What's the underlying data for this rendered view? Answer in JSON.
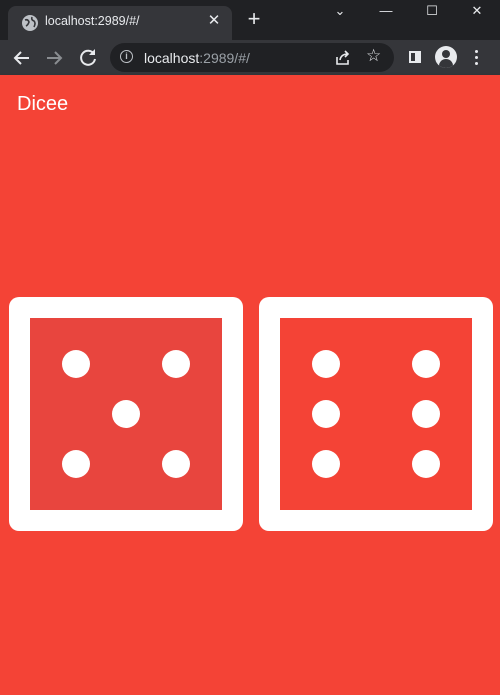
{
  "browser": {
    "tab_title": "localhost:2989/#/",
    "tab_close": "✕",
    "new_tab": "+",
    "url_host": "localhost",
    "url_rest": ":2989/#/",
    "controls": {
      "minimize": "—",
      "maximize": "☐",
      "close": "✕",
      "tab_search": "⌄"
    },
    "icons": {
      "back": "arrow-left-icon",
      "forward": "arrow-right-icon",
      "reload": "reload-icon",
      "info": "info-icon",
      "share": "share-icon",
      "bookmark": "star-icon",
      "side_panel": "side-panel-icon",
      "profile": "profile-icon",
      "menu": "kebab-menu-icon"
    }
  },
  "app": {
    "title": "Dicee",
    "theme": {
      "primary": "#f44336",
      "die_face": "#ffffff"
    },
    "dice": [
      {
        "value": 5,
        "icon": "dice-five-icon"
      },
      {
        "value": 6,
        "icon": "dice-six-icon"
      }
    ]
  }
}
